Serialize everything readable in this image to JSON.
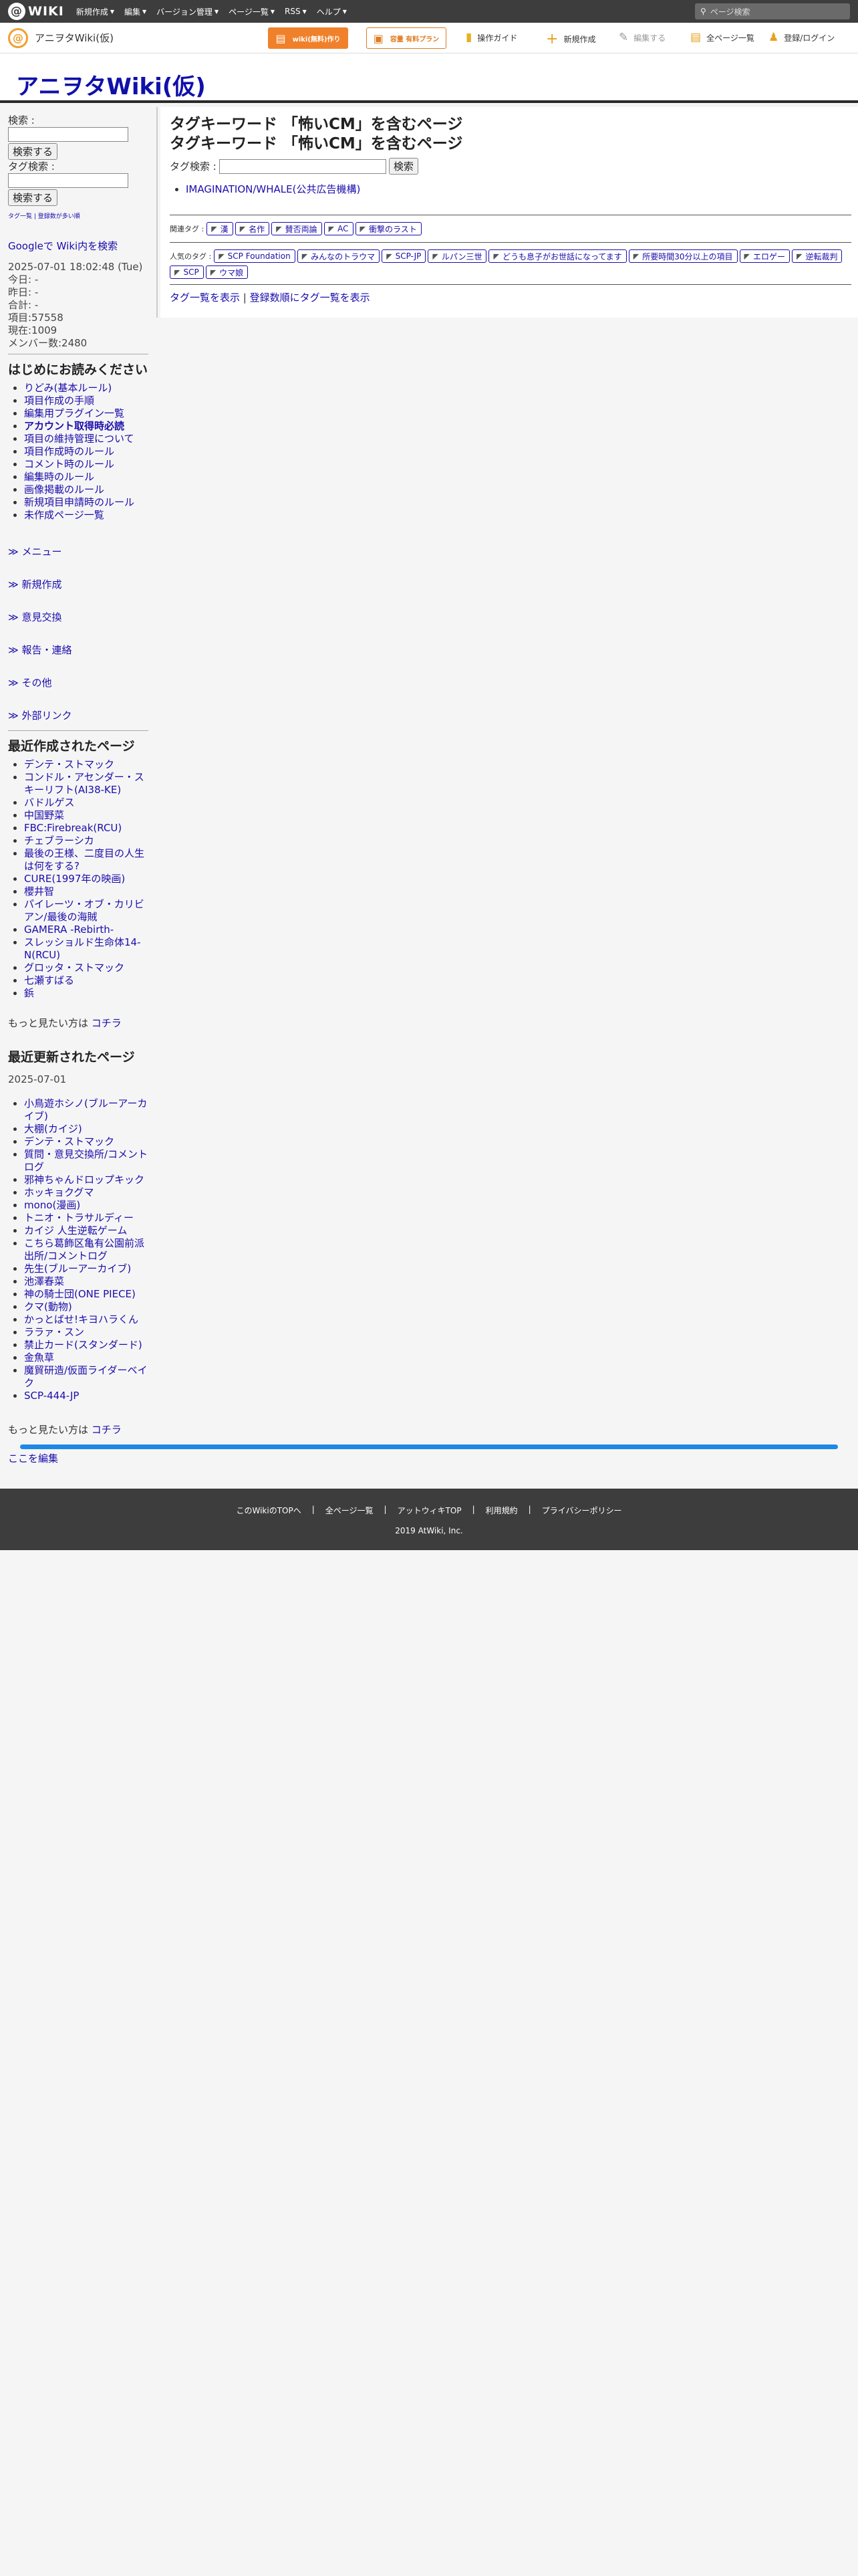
{
  "topbar": {
    "logo_text": "WIKI",
    "menu": [
      {
        "label": "新規作成"
      },
      {
        "label": "編集"
      },
      {
        "label": "バージョン管理"
      },
      {
        "label": "ページ一覧"
      },
      {
        "label": "RSS"
      },
      {
        "label": "ヘルプ"
      }
    ],
    "search_placeholder": "ページ検索"
  },
  "secondbar": {
    "site_name": "アニヲタWiki(仮)",
    "btn_create_wiki": "wiki(無料)作り",
    "btn_register": "容量 有料プラン",
    "actions": [
      {
        "label": "操作ガイド",
        "icon": "guide-icon"
      },
      {
        "label": "新規作成",
        "icon": "plus-icon"
      },
      {
        "label": "編集する",
        "icon": "pencil-icon"
      },
      {
        "label": "全ページ一覧",
        "icon": "document-icon"
      },
      {
        "label": "登録/ログイン",
        "icon": "users-icon"
      }
    ]
  },
  "page_title": "アニヲタWiki(仮)",
  "sidebar": {
    "search_label": "検索 :",
    "search_button": "検索する",
    "tag_search_label": "タグ検索 :",
    "tag_search_button": "検索する",
    "tiny_links": "タグ一覧 | 登録数が多い順",
    "google_search": "Googleで Wiki内を検索",
    "stats": [
      "2025-07-01 18:02:48 (Tue)",
      "今日: -",
      "昨日: -",
      "合計: -",
      "項目:57558",
      "現在:1009",
      "メンバー数:2480"
    ],
    "intro_heading": "はじめにお読みください",
    "intro_items": [
      "りどみ(基本ルール)",
      "項目作成の手順",
      "編集用プラグイン一覧",
      "アカウント取得時必読",
      "項目の維持管理について",
      "項目作成時のルール",
      "コメント時のルール",
      "編集時のルール",
      "画像掲載のルール",
      "新規項目申請時のルール",
      "未作成ページ一覧"
    ],
    "folds": [
      "≫ メニュー",
      "≫ 新規作成",
      "≫ 意見交換",
      "≫ 報告・連絡",
      "≫ その他",
      "≫ 外部リンク"
    ],
    "recent_created_heading": "最近作成されたページ",
    "recent_created": [
      "デンテ・ストマック",
      "コンドル・アセンダー・スキーリフト(AI38-KE)",
      "バドルゲス",
      "中国野菜",
      "FBC:Firebreak(RCU)",
      "チェブラーシカ",
      "最後の王様、二度目の人生は何をする?",
      "CURE(1997年の映画)",
      "櫻井智",
      "パイレーツ・オブ・カリビアン/最後の海賊",
      "GAMERA -Rebirth-",
      "スレッショルド生命体14-N(RCU)",
      "グロッタ・ストマック",
      "七瀬すばる",
      "鋲"
    ],
    "more_text": "もっと見たい方は",
    "more_link": "コチラ",
    "recent_updated_heading": "最近更新されたページ",
    "recent_updated_date": "2025-07-01",
    "recent_updated": [
      "小鳥遊ホシノ(ブルーアーカイブ)",
      "大棚(カイジ)",
      "デンテ・ストマック",
      "質問・意見交換所/コメントログ",
      "邪神ちゃんドロップキック",
      "ホッキョクグマ",
      "mono(漫画)",
      "トニオ・トラサルディー",
      "カイジ 人生逆転ゲーム",
      "こちら葛飾区亀有公園前派出所/コメントログ",
      "先生(ブルーアーカイブ)",
      "池澤春菜",
      "神の騎士団(ONE PIECE)",
      "クマ(動物)",
      "かっとばせ!キヨハラくん",
      "ララァ・スン",
      "禁止カード(スタンダード)",
      "金魚草",
      "魔貿研造/仮面ライダーベイク",
      "SCP-444-JP"
    ],
    "more_text_2": "もっと見たい方は",
    "more_link_2": "コチラ",
    "edit_here": "ここを編集"
  },
  "main": {
    "heading_line1": "タグキーワード 「怖いCM」を含むページ",
    "heading_line2": "タグキーワード 「怖いCM」を含むページ",
    "tag_search_label": "タグ検索 :",
    "tag_search_button": "検索",
    "results": [
      "IMAGINATION/WHALE(公共広告機構)"
    ],
    "related_label": "関連タグ :",
    "related_tags": [
      "漢",
      "名作",
      "賛否両論",
      "AC",
      "衝撃のラスト"
    ],
    "popular_label": "人気のタグ :",
    "popular_tags": [
      "SCP Foundation",
      "みんなのトラウマ",
      "SCP-JP",
      "ルパン三世",
      "どうも息子がお世話になってます",
      "所要時間30分以上の項目",
      "エロゲー",
      "逆転裁判",
      "SCP",
      "ウマ娘"
    ],
    "link_tag_list": "タグ一覧を表示",
    "link_sep": "|",
    "link_tag_by_count": "登録数順にタグ一覧を表示"
  },
  "footer": {
    "links": [
      "このWikiのTOPへ",
      "全ページ一覧",
      "アットウィキTOP",
      "利用規約",
      "プライバシーポリシー"
    ],
    "copyright": "2019 AtWiki, Inc."
  }
}
